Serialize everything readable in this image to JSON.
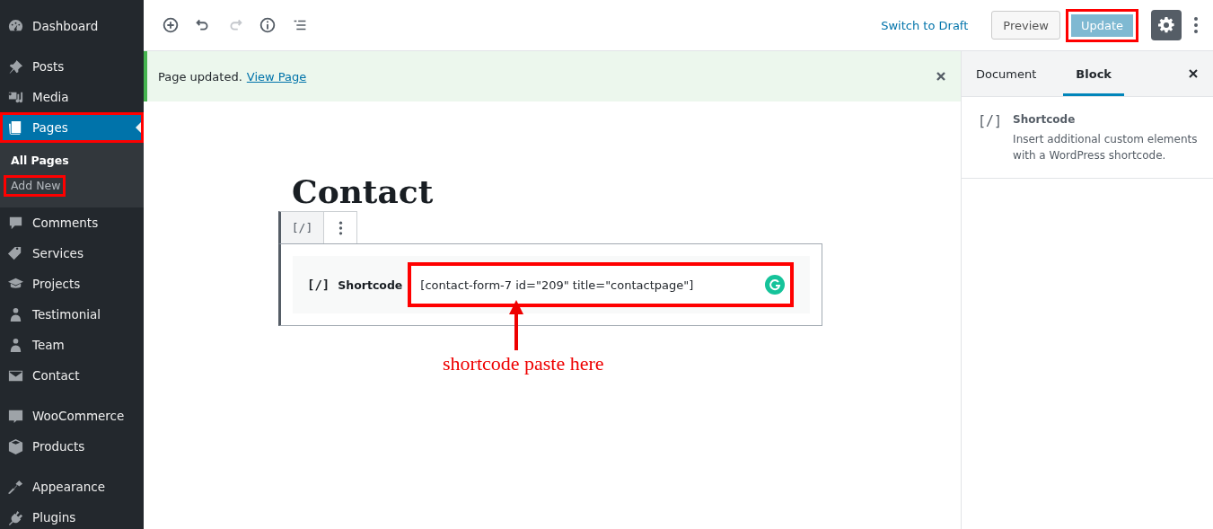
{
  "sidebar": {
    "groups": [
      [
        {
          "label": "Dashboard",
          "selected": false,
          "highlighted": false
        }
      ],
      [
        {
          "label": "Posts",
          "selected": false,
          "highlighted": false
        },
        {
          "label": "Media",
          "selected": false,
          "highlighted": false
        },
        {
          "label": "Pages",
          "selected": true,
          "highlighted": true,
          "children": [
            {
              "label": "All Pages",
              "selected": true,
              "highlighted": false
            },
            {
              "label": "Add New",
              "selected": false,
              "highlighted": true
            }
          ]
        },
        {
          "label": "Comments",
          "selected": false,
          "highlighted": false
        },
        {
          "label": "Services",
          "selected": false,
          "highlighted": false
        },
        {
          "label": "Projects",
          "selected": false,
          "highlighted": false
        },
        {
          "label": "Testimonial",
          "selected": false,
          "highlighted": false
        },
        {
          "label": "Team",
          "selected": false,
          "highlighted": false
        },
        {
          "label": "Contact",
          "selected": false,
          "highlighted": false
        }
      ],
      [
        {
          "label": "WooCommerce",
          "selected": false,
          "highlighted": false
        },
        {
          "label": "Products",
          "selected": false,
          "highlighted": false
        }
      ],
      [
        {
          "label": "Appearance",
          "selected": false,
          "highlighted": false
        },
        {
          "label": "Plugins",
          "selected": false,
          "highlighted": false
        }
      ]
    ]
  },
  "toolbar": {
    "tools": [
      {
        "disabled": false
      },
      {
        "disabled": false
      },
      {
        "disabled": true
      },
      {
        "disabled": false
      },
      {
        "disabled": false
      }
    ],
    "switch_link": "Switch to Draft",
    "preview_button": "Preview",
    "update_button": {
      "label": "Update",
      "disabled": true,
      "highlighted": true
    },
    "settings_pressed": true
  },
  "notice": {
    "text": "Page updated.",
    "link": "View Page"
  },
  "editor": {
    "title": "Contact",
    "block_toolbar_icon": "[/]",
    "block": {
      "icon": "[/]",
      "label": "Shortcode",
      "value": "[contact-form-7 id=\"209\" title=\"contactpage\"]",
      "highlighted": true
    },
    "annotation": "shortcode paste here"
  },
  "settings_panel": {
    "tabs": [
      {
        "label": "Document",
        "selected": false
      },
      {
        "label": "Block",
        "selected": true
      }
    ],
    "block_icon": "[/]",
    "block_title": "Shortcode",
    "block_description": "Insert additional custom elements with a WordPress shortcode."
  }
}
